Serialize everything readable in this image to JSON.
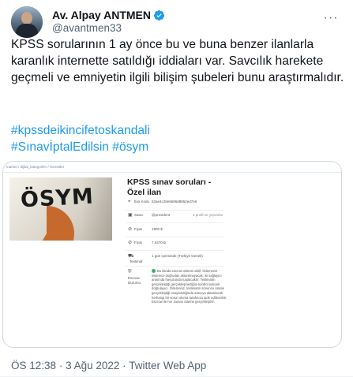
{
  "author": {
    "name": "Av. Alpay ANTMEN",
    "handle": "@avantmen33",
    "verified_icon": "verified-badge-icon",
    "verified_color": "#1d9bf0"
  },
  "tweet": {
    "text": "KPSS sorularının 1 ay önce bu ve buna benzer ilanlarla karanlık internette satıldığı iddiaları var. Savcılık harekete geçmeli ve emniyetin ilgili bilişim şubeleri bunu araştırmalıdır.",
    "hashtags": [
      "#kpssdeikincifetoskandali",
      "#SınavİptalEdilsin #ösym"
    ],
    "hashtag_color": "#1d9bf0"
  },
  "media": {
    "breadcrumb": "market / dijital_kategoriler / hizmetler",
    "photo_word": "ÖSYM",
    "listing_title": "KPSS sınav soruları - Özel ilan",
    "rows": [
      {
        "icon": "tag-icon",
        "label": "İlan Kodu",
        "value": "62ae4c28e6686d8652ed7e6",
        "extra": ""
      },
      {
        "icon": "store-icon",
        "label": "Satıcı",
        "value": "@president",
        "extra": "4 profil ve yorumlar"
      },
      {
        "icon": "price-icon",
        "label": "Fiyat",
        "value": "1900 $",
        "extra": ""
      },
      {
        "icon": "price-icon",
        "label": "Fiyat",
        "value": "7.0470 Ƀ",
        "extra": ""
      },
      {
        "icon": "truck-icon",
        "label": "Teslimat",
        "value": "1 gün içerisinde (Türkiye Geneli)",
        "extra": ""
      }
    ],
    "escrow_label": "Escrow Durumu",
    "escrow_text": "Bu ilanda escrow sistemi aktif. Ödemeniz sistemce doğrudan aktarılmayacak; iki sağlayıcı arasında havuzunda tutulacaktır. Teslimatın gerçekleştiği gerçekleşmediğini kontrol edecek doğrulayıcı. Ödemeniz, teslimatın sonuncu olarak gerçekleştiği onaylandığında satıcıya aktarılacak herhangi bir sorun olursa tarafınıza iade edilecektir. Escrow ile her zaman ödeme gerçekleştirir."
  },
  "meta": {
    "time": "ÖS 12:38",
    "date": "3 Ağu 2022",
    "source": "Twitter Web App",
    "separator": "·"
  }
}
